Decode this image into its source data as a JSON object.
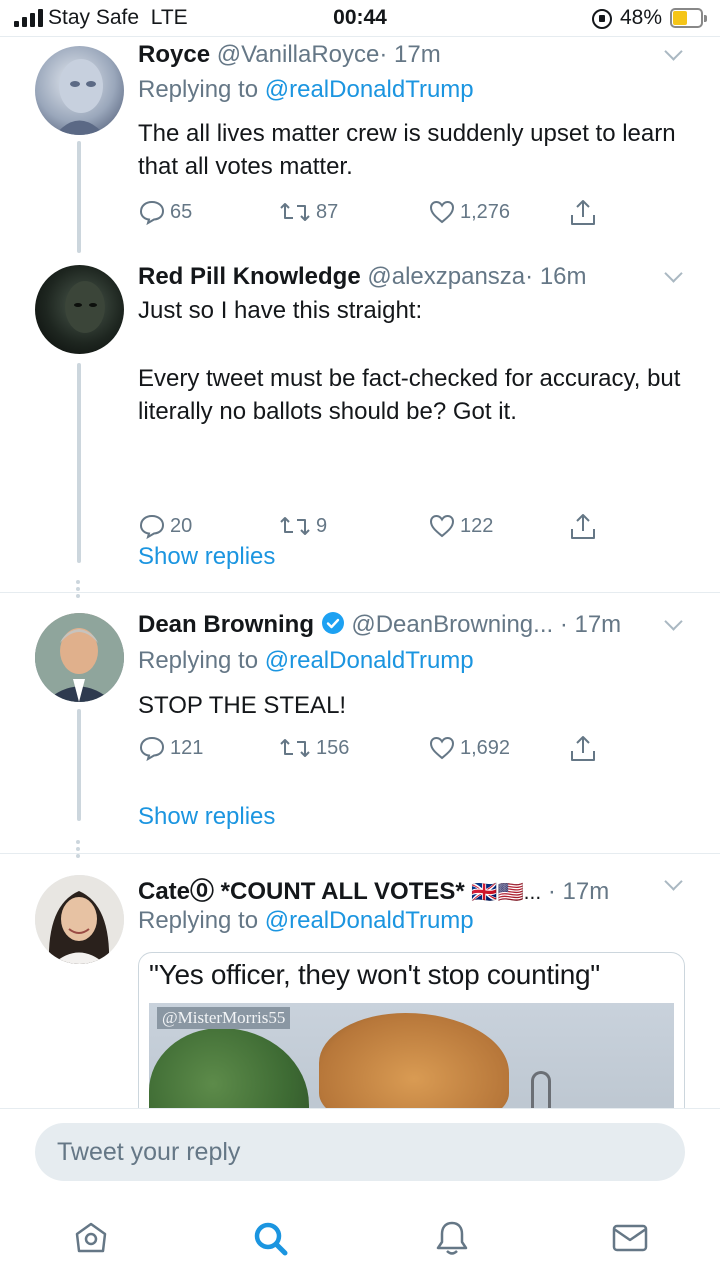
{
  "status_bar": {
    "carrier": "Stay Safe",
    "network": "LTE",
    "time": "00:44",
    "battery_percent": "48%",
    "battery_level": 0.48
  },
  "tweets": [
    {
      "name": "Royce",
      "handle": "@VanillaRoyce",
      "time": "· 17m",
      "reply_prefix": "Replying to",
      "reply_mention": "@realDonaldTrump",
      "text": [
        "The all lives matter crew is suddenly upset to learn that all votes matter."
      ],
      "replies": "65",
      "retweets": "87",
      "likes": "1,276"
    },
    {
      "name": "Red Pill Knowledge",
      "handle": "@alexzpansza",
      "time": "· 16m",
      "text": [
        "Just so I have this straight:",
        "Every tweet must be fact-checked for accuracy, but literally no ballots should be? Got it."
      ],
      "replies": "20",
      "retweets": "9",
      "likes": "122",
      "show_replies": "Show replies"
    },
    {
      "name": "Dean Browning",
      "handle": "@DeanBrowning...",
      "time": "· 17m",
      "reply_prefix": "Replying to",
      "reply_mention": "@realDonaldTrump",
      "text": [
        "STOP THE STEAL!"
      ],
      "replies": "121",
      "retweets": "156",
      "likes": "1,692",
      "show_replies": "Show replies"
    },
    {
      "name": "Cate⓪ *COUNT ALL VOTES*",
      "flags": "🇬🇧🇺🇸...",
      "time": "· 17m",
      "reply_prefix": "Replying to",
      "reply_mention": "@realDonaldTrump",
      "media_caption": "\"Yes officer, they won't stop counting\"",
      "media_watermark": "@MisterMorris55"
    }
  ],
  "reply_bar": {
    "placeholder": "Tweet your reply"
  },
  "tab_bar": [
    "home-icon",
    "search-icon",
    "notifications-icon",
    "messages-icon"
  ],
  "colors": {
    "accent": "#1b95e0",
    "secondary_text": "#657786",
    "verified": "#1da1f2"
  }
}
